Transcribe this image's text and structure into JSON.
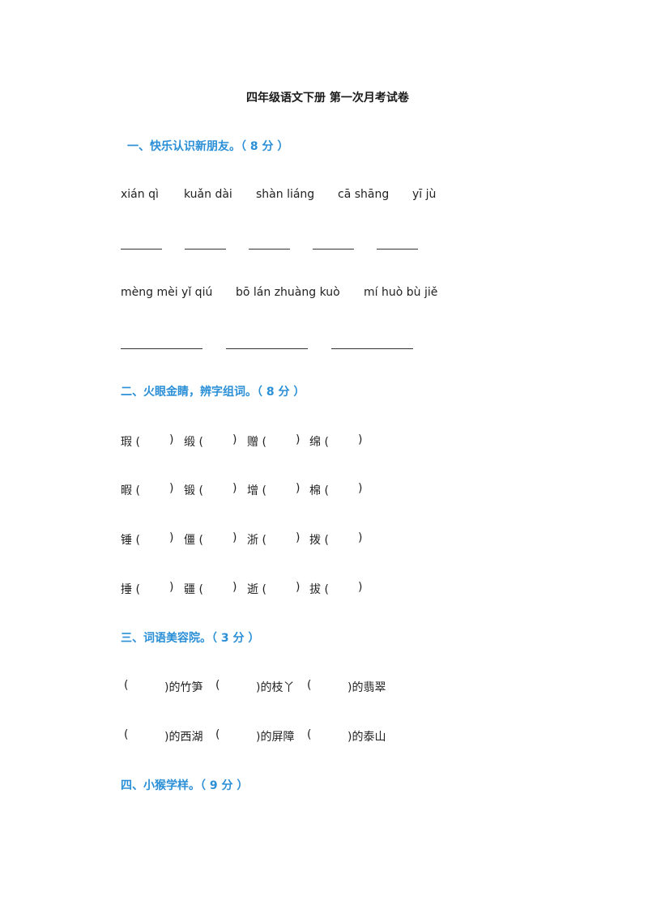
{
  "title": "四年级语文下册 第一次月考试卷",
  "sections": [
    {
      "heading": "一、快乐认识新朋友。（ 8 分 ）",
      "pinyin_row1": [
        "xián qì",
        "kuǎn dài",
        "shàn liáng",
        "cā shāng",
        "yī jù"
      ],
      "pinyin_row2": [
        "mèng mèi yǐ qiú",
        "bō lán zhuàng kuò",
        "mí huò bù jiě"
      ]
    },
    {
      "heading": "二、火眼金睛，辨字组词。（ 8 分 ）",
      "rows": [
        [
          "瑕 (",
          "缎 (",
          "赠 (",
          "绵 ("
        ],
        [
          "暇 (",
          "锻 (",
          "增 (",
          "棉 ("
        ],
        [
          "锤 (",
          "僵 (",
          "浙 (",
          "拨 ("
        ],
        [
          "捶 (",
          "疆 (",
          "逝 (",
          "拔 ("
        ]
      ],
      "close": ")"
    },
    {
      "heading": "三、词语美容院。（ 3 分 ）",
      "open": "(",
      "rows": [
        [
          ")的竹笋",
          ")的枝丫",
          ")的翡翠"
        ],
        [
          ")的西湖",
          ")的屏障",
          ")的泰山"
        ]
      ]
    },
    {
      "heading": "四、小猴学样。（ 9 分 ）"
    }
  ]
}
